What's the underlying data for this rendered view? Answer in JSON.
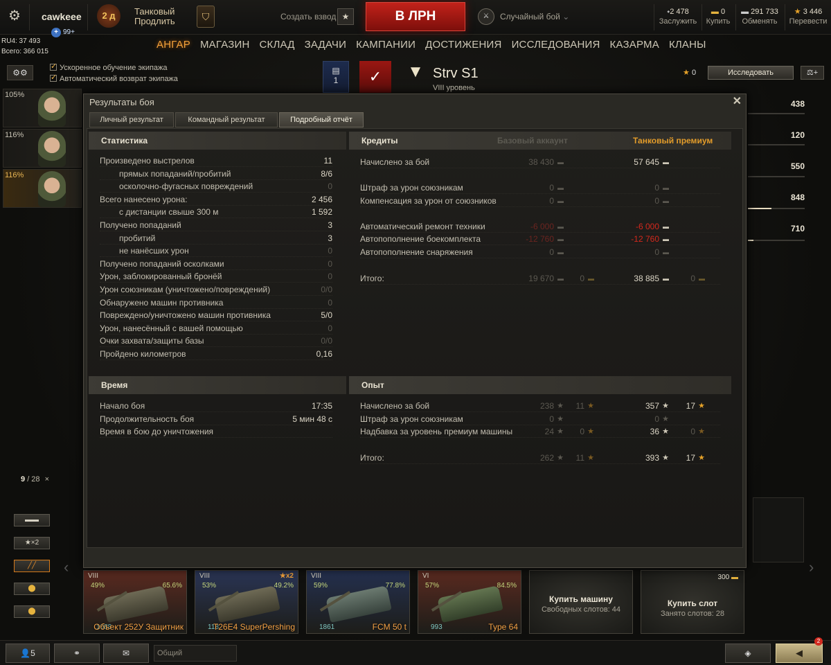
{
  "topbar": {
    "username": "cawkeee",
    "plus_badge": "99+",
    "premium_days": "2 д",
    "premium_title": "Танковый",
    "premium_action": "Продлить",
    "platoon_label": "Создать взвод",
    "battle_button": "В ЛРН",
    "mode_label": "Случайный бой",
    "mode_chevron": "⌄",
    "currencies": [
      {
        "value": "2 478",
        "label": "Заслужить"
      },
      {
        "value": "0",
        "label": "Купить"
      },
      {
        "value": "291 733",
        "label": "Обменять"
      },
      {
        "value": "3 446",
        "label": "Перевести"
      }
    ]
  },
  "account": {
    "ru4": "RU4: 37 493",
    "total": "Всего: 366 015"
  },
  "nav": {
    "items": [
      "АНГАР",
      "МАГАЗИН",
      "СКЛАД",
      "ЗАДАЧИ",
      "КАМПАНИИ",
      "ДОСТИЖЕНИЯ",
      "ИССЛЕДОВАНИЯ",
      "КАЗАРМА",
      "КЛАНЫ"
    ],
    "active": "АНГАР"
  },
  "crew_options": {
    "accelerated": "Ускоренное обучение экипажа",
    "auto_return": "Автоматический возврат экипажа"
  },
  "crew": [
    {
      "pct": "105%"
    },
    {
      "pct": "116%"
    },
    {
      "pct": "116%"
    }
  ],
  "vehicle": {
    "name": "Strv S1",
    "level": "VIII уровень",
    "slot_num": "1",
    "free_xp": "0",
    "research": "Исследовать",
    "stats": [
      "438",
      "120",
      "550",
      "848",
      "710"
    ],
    "stat_fill": [
      0,
      0,
      0,
      0.42,
      0.1
    ]
  },
  "hangar": {
    "counter_current": "9",
    "counter_total": "/ 28",
    "filters": [
      "",
      "★×2",
      "",
      "",
      ""
    ]
  },
  "carousel": [
    {
      "level": "VIII",
      "wr": "49%",
      "mastery": "65.6%",
      "name": "Объект 252У Защитник",
      "xp": "1088"
    },
    {
      "level": "VIII",
      "wr": "53%",
      "mastery": "49.2%",
      "name": "T26E4 SuperPershing",
      "xp": "118",
      "bonus": "★x2"
    },
    {
      "level": "VIII",
      "wr": "59%",
      "mastery": "77.8%",
      "name": "FCM 50 t",
      "xp": "1861"
    },
    {
      "level": "VI",
      "wr": "57%",
      "mastery": "84.5%",
      "name": "Type 64",
      "xp": "993"
    }
  ],
  "buy_vehicle": {
    "title": "Купить машину",
    "sub": "Свободных слотов: 44"
  },
  "buy_slot": {
    "title": "Купить слот",
    "sub": "Занято слотов: 28",
    "price": "300"
  },
  "bottombar": {
    "friends": "5",
    "chat_placeholder": "Общий",
    "notif_count": "2"
  },
  "results": {
    "title": "Результаты боя",
    "tabs": [
      "Личный результат",
      "Командный результат",
      "Подробный отчёт"
    ],
    "active_tab": "Подробный отчёт",
    "stats_header": "Статистика",
    "stats": [
      {
        "label": "Произведено выстрелов",
        "value": "11",
        "indent": false,
        "dim": false
      },
      {
        "label": "прямых попаданий/пробитий",
        "value": "8/6",
        "indent": true,
        "dim": false
      },
      {
        "label": "осколочно-фугасных повреждений",
        "value": "0",
        "indent": true,
        "dim": true
      },
      {
        "label": "Всего нанесено урона:",
        "value": "2 456",
        "indent": false,
        "dim": false
      },
      {
        "label": "с дистанции свыше 300 м",
        "value": "1 592",
        "indent": true,
        "dim": false
      },
      {
        "label": "Получено попаданий",
        "value": "3",
        "indent": false,
        "dim": false
      },
      {
        "label": "пробитий",
        "value": "3",
        "indent": true,
        "dim": false
      },
      {
        "label": "не нанёсших урон",
        "value": "0",
        "indent": true,
        "dim": true
      },
      {
        "label": "Получено попаданий осколками",
        "value": "0",
        "indent": false,
        "dim": true
      },
      {
        "label": "Урон, заблокированный бронёй",
        "value": "0",
        "indent": false,
        "dim": true
      },
      {
        "label": "Урон союзникам (уничтожено/повреждений)",
        "value": "0/0",
        "indent": false,
        "dim": true
      },
      {
        "label": "Обнаружено машин противника",
        "value": "0",
        "indent": false,
        "dim": true
      },
      {
        "label": "Повреждено/уничтожено машин противника",
        "value": "5/0",
        "indent": false,
        "dim": false
      },
      {
        "label": "Урон, нанесённый с вашей помощью",
        "value": "0",
        "indent": false,
        "dim": true
      },
      {
        "label": "Очки захвата/защиты базы",
        "value": "0/0",
        "indent": false,
        "dim": true
      },
      {
        "label": "Пройдено километров",
        "value": "0,16",
        "indent": false,
        "dim": false
      }
    ],
    "credits_header": "Кредиты",
    "col_base": "Базовый аккаунт",
    "col_prem": "Танковый премиум",
    "credits": [
      {
        "label": "Начислено за бой",
        "base": "38 430",
        "prem": "57 645",
        "base_red": false,
        "prem_red": false,
        "base_dim": true,
        "prem_dim": false
      },
      {
        "label": "Штраф за урон союзникам",
        "base": "0",
        "prem": "0",
        "base_red": false,
        "prem_red": false,
        "base_dim": true,
        "prem_dim": true
      },
      {
        "label": "Компенсация за урон от союзников",
        "base": "0",
        "prem": "0",
        "base_red": false,
        "prem_red": false,
        "base_dim": true,
        "prem_dim": true
      },
      {
        "label": "Автоматический ремонт техники",
        "base": "-6 000",
        "prem": "-6 000",
        "base_red": true,
        "prem_red": true,
        "base_dim": true,
        "prem_dim": false
      },
      {
        "label": "Автопополнение боекомплекта",
        "base": "-12 760",
        "prem": "-12 760",
        "base_red": true,
        "prem_red": true,
        "base_dim": true,
        "prem_dim": false
      },
      {
        "label": "Автопополнение снаряжения",
        "base": "0",
        "prem": "0",
        "base_red": false,
        "prem_red": false,
        "base_dim": true,
        "prem_dim": true
      }
    ],
    "credits_total_label": "Итого:",
    "credits_total_base": "19 670",
    "credits_total_base_gold": "0",
    "credits_total_prem": "38 885",
    "credits_total_prem_gold": "0",
    "time_header": "Время",
    "time": [
      {
        "label": "Начало боя",
        "value": "17:35"
      },
      {
        "label": "Продолжительность боя",
        "value": "5 мин 48 с"
      },
      {
        "label": "Время в бою до уничтожения",
        "value": ""
      }
    ],
    "xp_header": "Опыт",
    "xp": [
      {
        "label": "Начислено за бой",
        "base": "238",
        "base_free": "11",
        "prem": "357",
        "prem_free": "17",
        "prem_free_dim": false,
        "prem_dim": false
      },
      {
        "label": "Штраф за урон союзникам",
        "base": "0",
        "base_free": "",
        "prem": "0",
        "prem_free": "",
        "prem_free_dim": true,
        "prem_dim": true
      },
      {
        "label": "Надбавка за уровень премиум машины",
        "base": "24",
        "base_free": "0",
        "prem": "36",
        "prem_free": "0",
        "prem_free_dim": true,
        "prem_dim": false
      }
    ],
    "xp_total_label": "Итого:",
    "xp_total_base": "262",
    "xp_total_base_free": "11",
    "xp_total_prem": "393",
    "xp_total_prem_free": "17"
  },
  "colors": {
    "accent": "#f2a13a",
    "battle": "#b81d16",
    "penalty": "#d4281d",
    "prem_header": "#e39c2a"
  }
}
